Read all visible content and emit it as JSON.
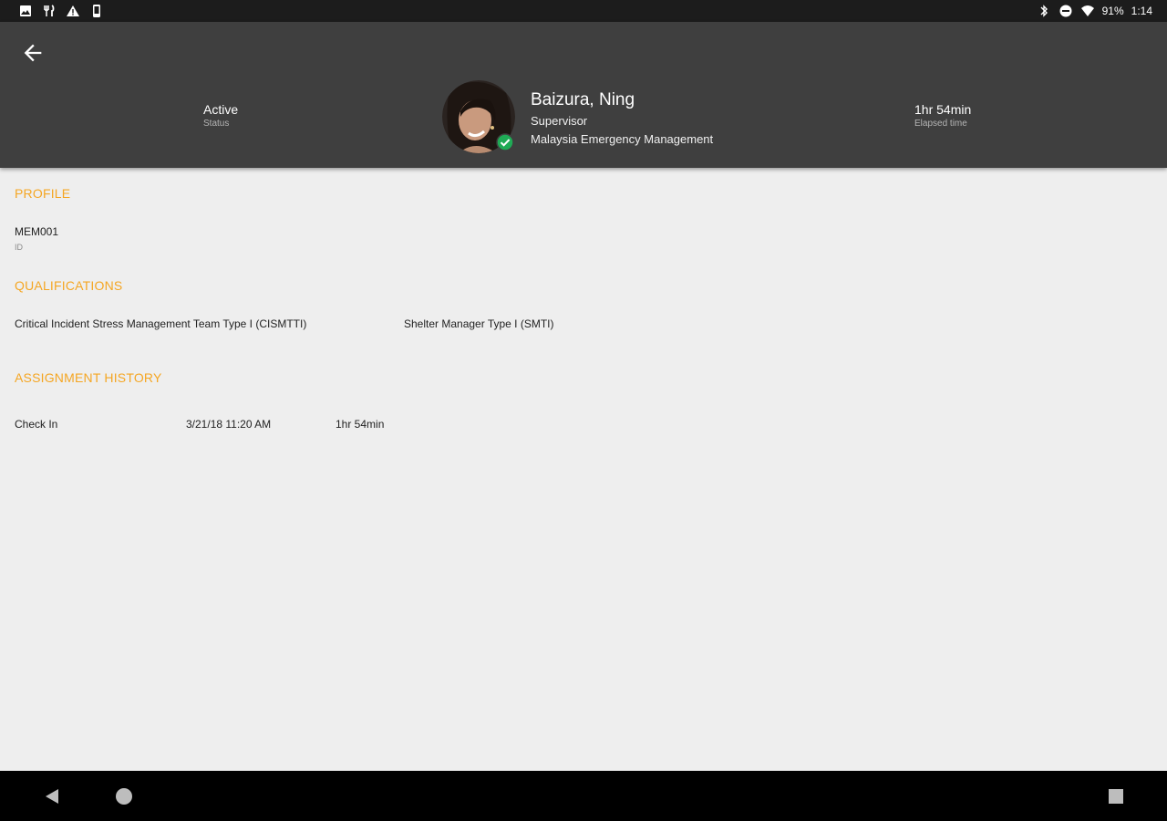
{
  "status_bar": {
    "battery": "91%",
    "time": "1:14",
    "left_icons": [
      "image-icon",
      "restaurant-icon",
      "warning-icon",
      "phone-icon"
    ],
    "right_icons": [
      "bluetooth-icon",
      "do-not-disturb-icon",
      "wifi-icon"
    ]
  },
  "header": {
    "status_value": "Active",
    "status_label": "Status",
    "name": "Baizura, Ning",
    "role": "Supervisor",
    "organization": "Malaysia Emergency Management",
    "elapsed_value": "1hr 54min",
    "elapsed_label": "Elapsed time"
  },
  "profile": {
    "title": "PROFILE",
    "id_value": "MEM001",
    "id_label": "ID"
  },
  "qualifications": {
    "title": "QUALIFICATIONS",
    "items": [
      "Critical Incident Stress Management Team Type I (CISMTTI)",
      "Shelter Manager Type I (SMTI)"
    ]
  },
  "assignment_history": {
    "title": "ASSIGNMENT HISTORY",
    "rows": [
      {
        "event": "Check In",
        "datetime": "3/21/18 11:20 AM",
        "duration": "1hr 54min"
      }
    ]
  },
  "colors": {
    "accent": "#f5a623",
    "header_bg": "#3f3f3f",
    "verified": "#1faa55",
    "background": "#eeeeee"
  }
}
